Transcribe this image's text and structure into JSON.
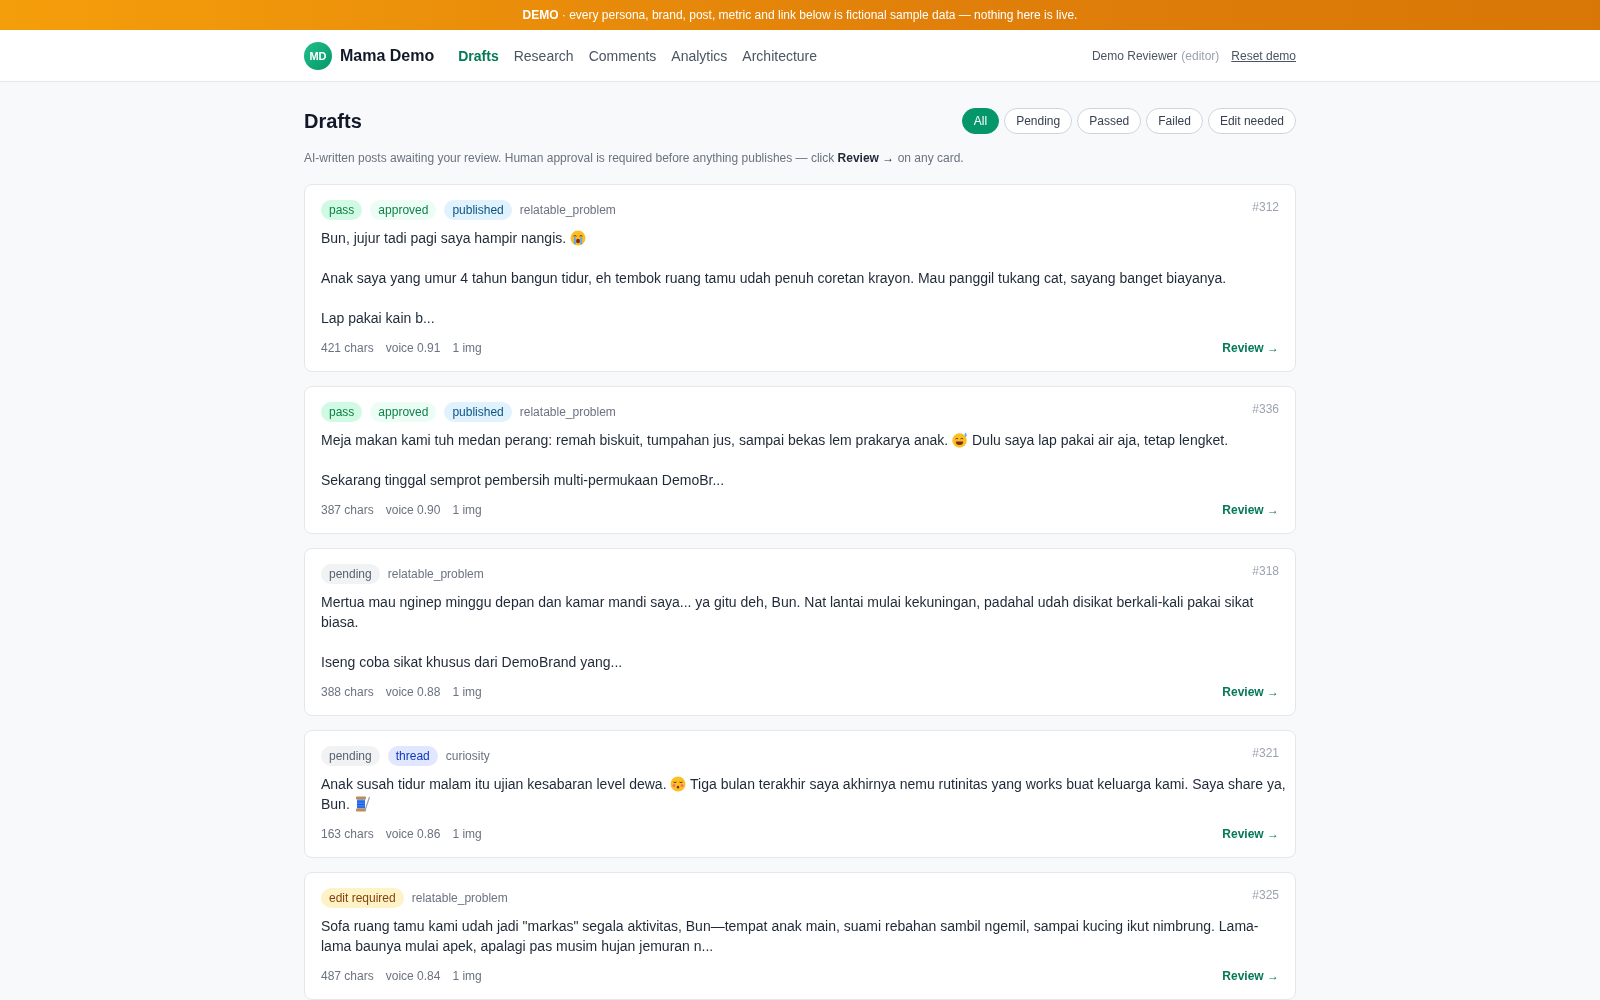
{
  "banner": {
    "text": "**DEMO** · every persona, brand, post, metric and link below is fictional sample data — nothing here is live."
  },
  "header": {
    "brand": {
      "initials": "MD",
      "name": "Mama Demo"
    },
    "nav": [
      {
        "label": "Drafts",
        "selected": true
      },
      {
        "label": "Research",
        "selected": false
      },
      {
        "label": "Comments",
        "selected": false
      },
      {
        "label": "Analytics",
        "selected": false
      },
      {
        "label": "Architecture",
        "selected": false
      }
    ],
    "user": {
      "name": "Demo Reviewer",
      "role": "(editor)"
    },
    "reset_link": "Reset demo"
  },
  "page": {
    "title": "Drafts",
    "filters": [
      {
        "label": "All",
        "selected": true
      },
      {
        "label": "Pending",
        "selected": false
      },
      {
        "label": "Passed",
        "selected": false
      },
      {
        "label": "Failed",
        "selected": false
      },
      {
        "label": "Edit needed",
        "selected": false
      }
    ],
    "description": "AI-written posts awaiting your review. Human approval is required before anything publishes — click **Review →** on any card."
  },
  "drafts": [
    {
      "id": "#312",
      "tags": [
        {
          "kind": "badge",
          "label": "pass",
          "color": "#d1fae5"
        },
        {
          "kind": "badge",
          "label": "approved",
          "color": "#ecfdf5"
        },
        {
          "kind": "badge",
          "label": "published",
          "color": "#e0f2fe"
        },
        {
          "kind": "plain",
          "label": "relatable_problem"
        }
      ],
      "paragraphs": [
        {
          "parts": [
            {
              "kind": "text",
              "text": "Bun, jujur tadi pagi saya hampir nangis."
            },
            {
              "kind": "crying_face"
            }
          ]
        },
        {
          "parts": [
            {
              "kind": "text",
              "text": "Anak saya yang umur 4 tahun bangun tidur, eh tembok ruang tamu udah penuh coretan krayon. Mau panggil tukang cat, sayang banget biayanya."
            }
          ]
        },
        {
          "parts": [
            {
              "kind": "text",
              "text": "Lap pakai kain b..."
            }
          ]
        }
      ],
      "stats": [
        "421 chars",
        "voice 0.91",
        "1 img"
      ],
      "action": "Review →"
    },
    {
      "id": "#336",
      "tags": [
        {
          "kind": "badge",
          "label": "pass",
          "color": "#d1fae5"
        },
        {
          "kind": "badge",
          "label": "approved",
          "color": "#ecfdf5"
        },
        {
          "kind": "badge",
          "label": "published",
          "color": "#e0f2fe"
        },
        {
          "kind": "plain",
          "label": "relatable_problem"
        }
      ],
      "paragraphs": [
        {
          "parts": [
            {
              "kind": "text",
              "text": "Meja makan kami tuh medan perang: remah biskuit, tumpahan jus, sampai bekas lem prakarya anak."
            },
            {
              "kind": "sweat_smile"
            },
            {
              "kind": "text",
              "text": "Dulu saya lap pakai air aja, tetap lengket."
            }
          ]
        },
        {
          "parts": [
            {
              "kind": "text",
              "text": "Sekarang tinggal semprot pembersih multi-permukaan DemoBr..."
            }
          ]
        }
      ],
      "stats": [
        "387 chars",
        "voice 0.90",
        "1 img"
      ],
      "action": "Review →"
    },
    {
      "id": "#318",
      "tags": [
        {
          "kind": "badge",
          "label": "pending",
          "color": "#f1f2f4"
        },
        {
          "kind": "plain",
          "label": "relatable_problem"
        }
      ],
      "paragraphs": [
        {
          "parts": [
            {
              "kind": "text",
              "text": "Mertua mau nginep minggu depan dan kamar mandi saya... ya gitu deh, Bun. Nat lantai mulai kekuningan, padahal udah disikat berkali-kali pakai sikat biasa."
            }
          ]
        },
        {
          "parts": [
            {
              "kind": "text",
              "text": "Iseng coba sikat khusus dari DemoBrand yang..."
            }
          ]
        }
      ],
      "stats": [
        "388 chars",
        "voice 0.88",
        "1 img"
      ],
      "action": "Review →"
    },
    {
      "id": "#321",
      "tags": [
        {
          "kind": "badge",
          "label": "pending",
          "color": "#f1f2f4"
        },
        {
          "kind": "badge",
          "label": "thread",
          "color": "#e0e7ff"
        },
        {
          "kind": "plain",
          "label": "curiosity"
        }
      ],
      "paragraphs": [
        {
          "parts": [
            {
              "kind": "text",
              "text": "Anak susah tidur malam itu ujian kesabaran level dewa."
            },
            {
              "kind": "closed_eyes_face"
            },
            {
              "kind": "text",
              "text": "Tiga bulan terakhir saya akhirnya nemu rutinitas yang works buat keluarga kami. Saya share ya,"
            },
            {
              "kind": "text",
              "text": "Bun."
            },
            {
              "kind": "thread_spool"
            }
          ]
        }
      ],
      "stats": [
        "163 chars",
        "voice 0.86",
        "1 img"
      ],
      "action": "Review →"
    },
    {
      "id": "#325",
      "tags": [
        {
          "kind": "badge",
          "label": "edit required",
          "color": "#fef3c7"
        },
        {
          "kind": "plain",
          "label": "relatable_problem"
        }
      ],
      "paragraphs": [
        {
          "parts": [
            {
              "kind": "text",
              "text": "Sofa ruang tamu kami udah jadi \"markas\" segala aktivitas, Bun—tempat anak main, suami rebahan sambil ngemil, sampai kucing ikut nimbrung. Lama-lama baunya mulai apek, apalagi pas musim hujan jemuran n..."
            }
          ]
        }
      ],
      "stats": [
        "487 chars",
        "voice 0.84",
        "1 img"
      ],
      "action": "Review →"
    }
  ]
}
